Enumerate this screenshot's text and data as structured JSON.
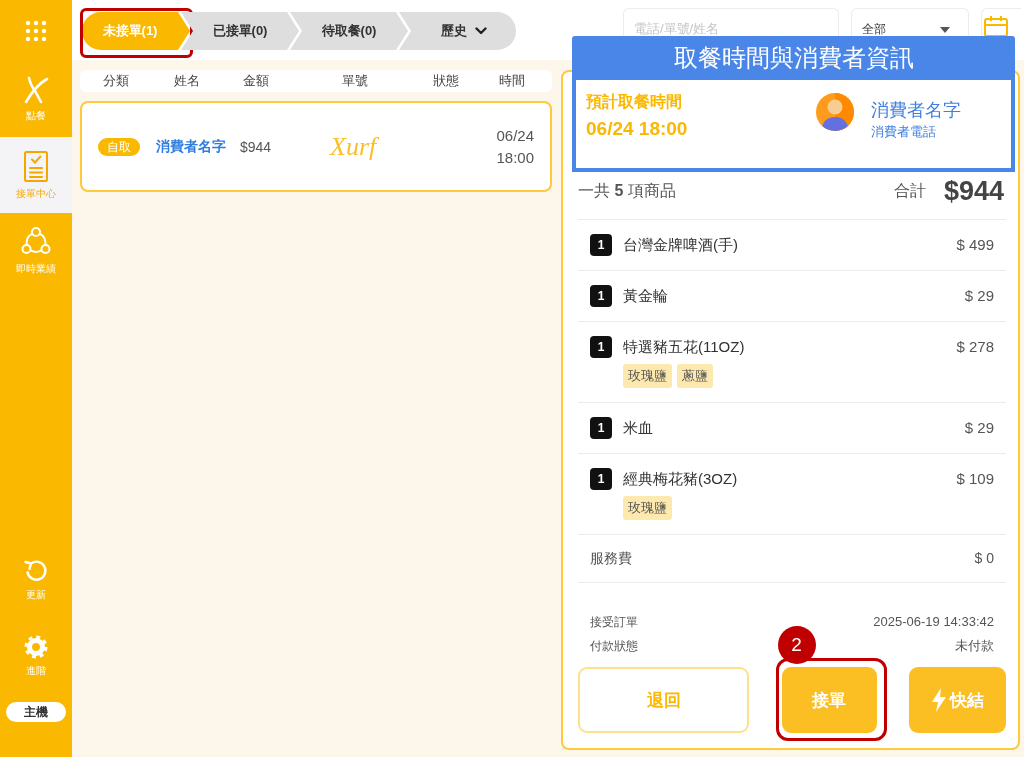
{
  "sidebar": {
    "items": [
      {
        "label": "點餐",
        "selected": false
      },
      {
        "label": "接單中心",
        "selected": true
      },
      {
        "label": "即時業績",
        "selected": false
      }
    ],
    "bottom_items": [
      {
        "label": "更新"
      },
      {
        "label": "進階"
      }
    ],
    "host_button": "主機"
  },
  "tabs": [
    {
      "label": "未接單(1)",
      "kind": "tab",
      "selected": true,
      "highlighted": true
    },
    {
      "label": "已接單(0)",
      "kind": "tab",
      "selected": false,
      "highlighted": false
    },
    {
      "label": "待取餐(0)",
      "kind": "tab",
      "selected": false,
      "highlighted": false
    },
    {
      "label": "歷史",
      "kind": "dropdown",
      "selected": false,
      "highlighted": false
    }
  ],
  "search": {
    "placeholder": "電話/單號/姓名"
  },
  "filter": {
    "value": "全部"
  },
  "order_table": {
    "columns": [
      "分類",
      "姓名",
      "金額",
      "單號",
      "狀態",
      "時間"
    ],
    "rows": [
      {
        "type": "自取",
        "customer": "消費者名字",
        "amount": "$944",
        "logo": "Xurf",
        "date": "06/24",
        "time": "18:00",
        "selected": true
      }
    ]
  },
  "callout": {
    "title": "取餐時間與消費者資訊",
    "pickup_label": "預計取餐時間",
    "pickup_time": "06/24 18:00",
    "customer_name": "消費者名字",
    "customer_phone": "消費者電話"
  },
  "order_detail": {
    "summary": "一共 **5** 項商品",
    "total_label": "合計",
    "total": "$944",
    "items": [
      {
        "qty": "1",
        "name": "台灣金牌啤酒(手)",
        "price": "$ 499"
      },
      {
        "qty": "1",
        "name": "黃金輪",
        "price": "$ 29"
      },
      {
        "qty": "1",
        "name": "特選豬五花(11OZ)",
        "price": "$ 278",
        "tags": [
          "玫瑰鹽",
          "蔥鹽"
        ]
      },
      {
        "qty": "1",
        "name": "米血",
        "price": "$ 29"
      },
      {
        "qty": "1",
        "name": "經典梅花豬(3OZ)",
        "price": "$ 109",
        "tags": [
          "玫瑰鹽"
        ]
      }
    ],
    "fees": [
      {
        "label": "服務費",
        "value": "$ 0"
      }
    ],
    "info": [
      {
        "label": "接受訂單",
        "value": "2025-06-19 14:33:42"
      },
      {
        "label": "付款狀態",
        "value": "未付款"
      }
    ],
    "buttons": [
      {
        "label": "退回",
        "kind": "outline",
        "highlighted": false
      },
      {
        "label": "接單",
        "kind": "primary",
        "highlighted": true,
        "step": "2"
      },
      {
        "label": "快結",
        "kind": "quick",
        "highlighted": false
      }
    ]
  }
}
